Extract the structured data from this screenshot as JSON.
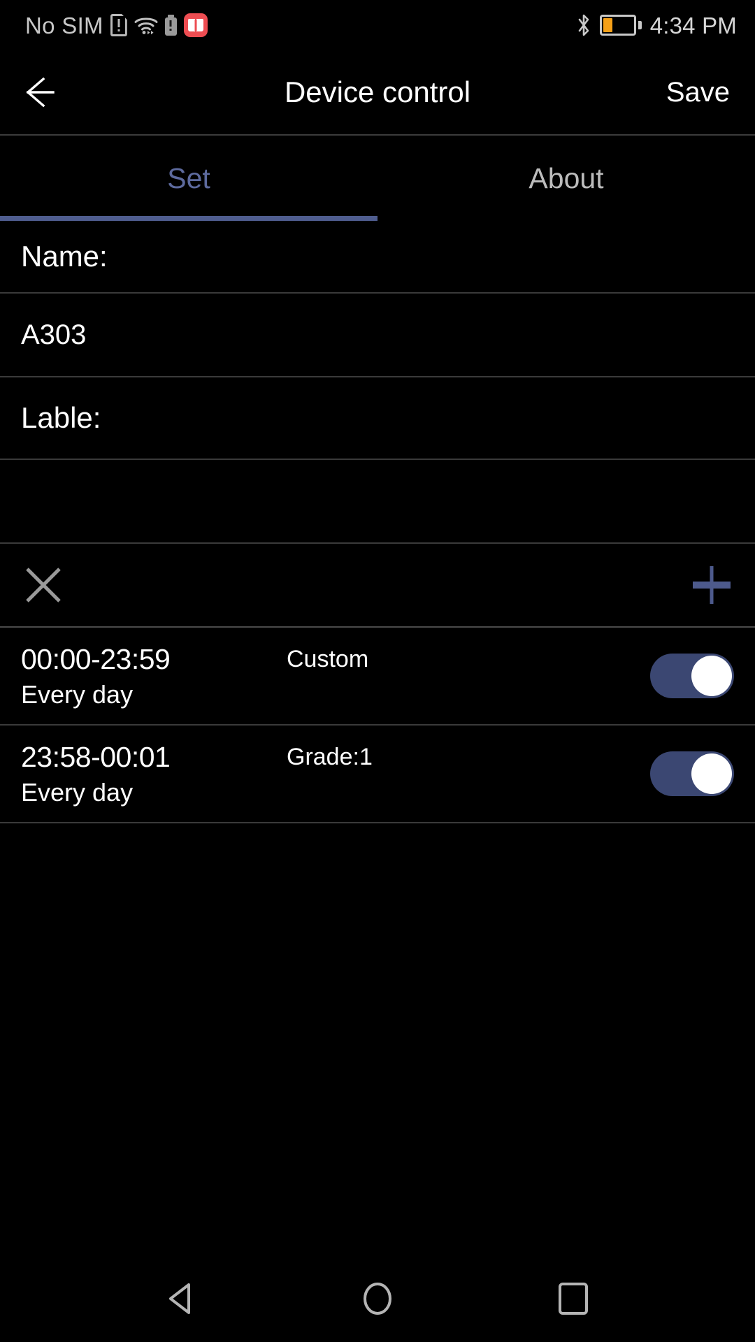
{
  "status_bar": {
    "carrier": "No SIM",
    "time": "4:34 PM",
    "icons": [
      "sim-card-error-icon",
      "wifi-icon",
      "battery-alert-icon",
      "book-app-icon",
      "bluetooth-icon",
      "battery-icon"
    ],
    "battery_level_percent": 25,
    "battery_fill_color": "#f5a018",
    "book_icon_color": "#ee4d52"
  },
  "app_bar": {
    "back_label": "back-arrow",
    "title": "Device control",
    "save_label": "Save"
  },
  "tabs": {
    "items": [
      {
        "label": "Set",
        "active": true
      },
      {
        "label": "About",
        "active": false
      }
    ],
    "active_color": "#5d6a9e",
    "inactive_color": "#bcbcbc",
    "indicator_color": "#4f5d8f"
  },
  "form": {
    "name_label": "Name:",
    "name_value": "A303",
    "lable_label": "Lable:",
    "lable_value": ""
  },
  "actions": {
    "delete_icon": "close-x-icon",
    "add_icon": "plus-icon",
    "delete_color": "#9a9a9a",
    "add_color": "#4d5a8c"
  },
  "schedules": [
    {
      "time_range": "00:00-23:59",
      "mode": "Custom",
      "repeat": "Every day",
      "enabled": true
    },
    {
      "time_range": "23:58-00:01",
      "mode": "Grade:1",
      "repeat": "Every day",
      "enabled": true
    }
  ],
  "toggle_on_color": "#3b4772",
  "nav_bar": {
    "back": "triangle-back-icon",
    "home": "circle-home-icon",
    "recents": "square-recents-icon"
  }
}
